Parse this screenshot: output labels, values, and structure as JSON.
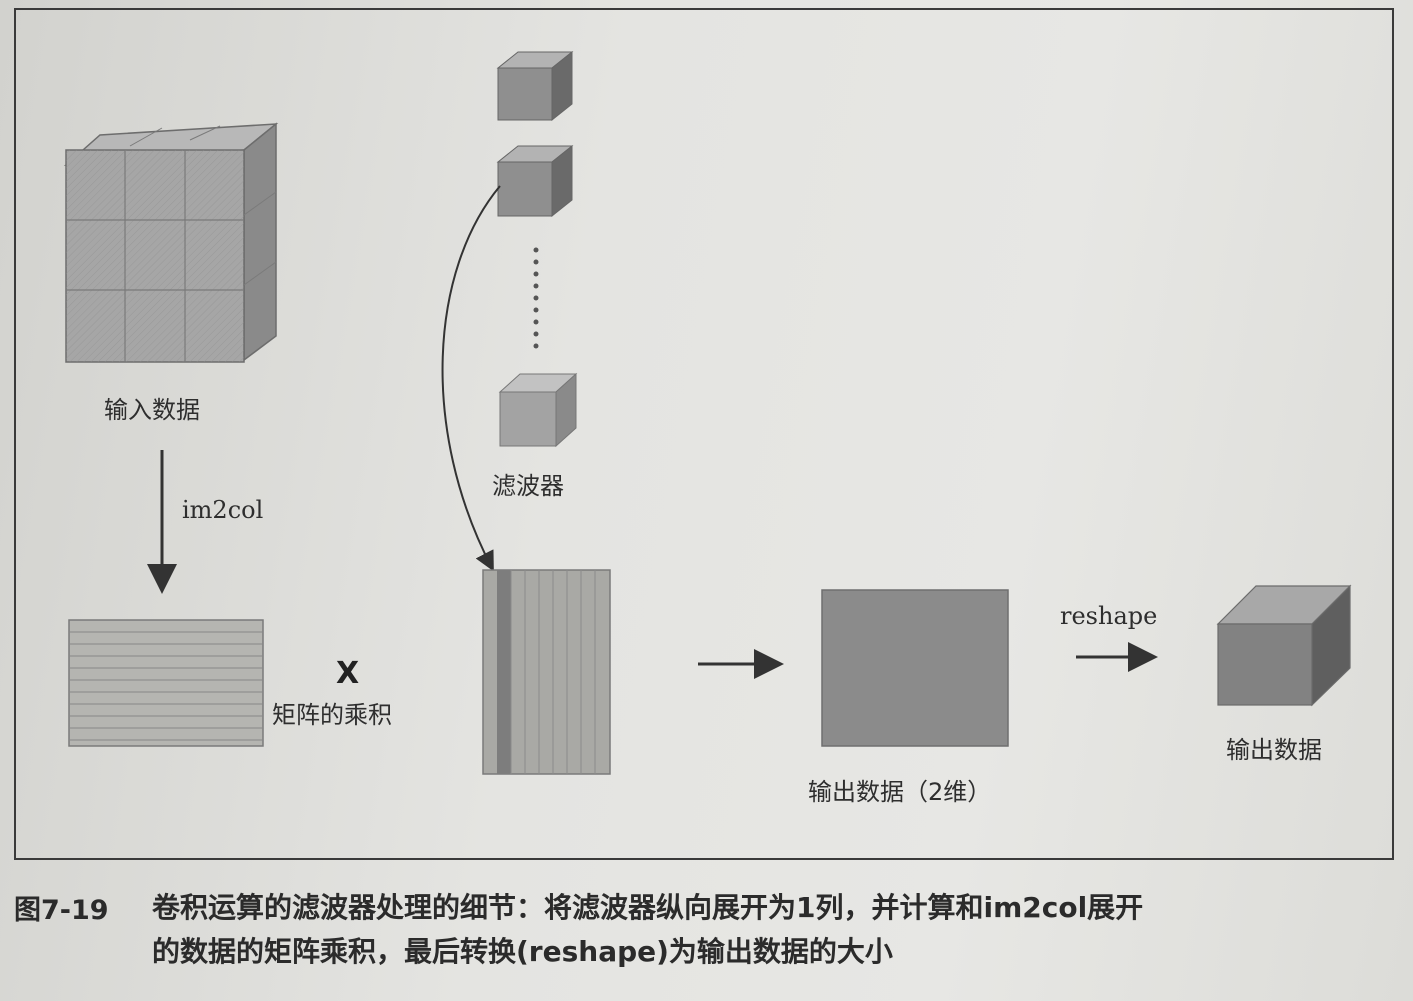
{
  "labels": {
    "input_data": "输入数据",
    "im2col": "im2col",
    "filter": "滤波器",
    "times_symbol": "X",
    "matrix_product": "矩阵的乘积",
    "output_2d": "输出数据（2维）",
    "reshape": "reshape",
    "output_data": "输出数据"
  },
  "caption": {
    "number": "图7-19",
    "line1": "卷积运算的滤波器处理的细节：将滤波器纵向展开为1列，并计算和im2col展开",
    "line2": "的数据的矩阵乘积，最后转换(reshape)为输出数据的大小"
  },
  "colors": {
    "box_front": "#8c8c8c",
    "box_top": "#b3b3b3",
    "box_side": "#6a6a6a",
    "grid_stripe": "#7d7d7d",
    "arrow": "#333333"
  }
}
